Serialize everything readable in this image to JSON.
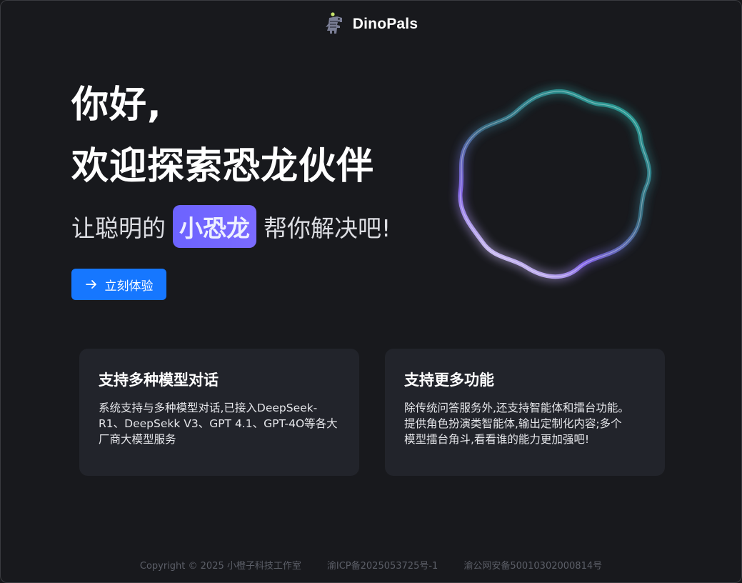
{
  "header": {
    "brand": "DinoPals",
    "logo_icon": "dinosaur-logo-icon"
  },
  "hero": {
    "greeting": "你好,",
    "title": "欢迎探索恐龙伙伴",
    "subtitle_before": "让聪明的",
    "subtitle_highlight": "小恐龙",
    "subtitle_after": "帮你解决吧!",
    "cta_label": "立刻体验",
    "cta_icon": "arrow-right-icon"
  },
  "colors": {
    "accent": "#1677ff",
    "highlight": "#6c63ff",
    "background": "#18191d",
    "card": "#22242b"
  },
  "cards": [
    {
      "title": "支持多种模型对话",
      "lines": [
        "系统支持与多种模型对话,已接入DeepSeek-",
        "R1、DeepSekk V3、GPT 4.1、GPT-4O等各大",
        "厂商大模型服务"
      ]
    },
    {
      "title": "支持更多功能",
      "lines": [
        "除传统问答服务外,还支持智能体和擂台功能。",
        "提供角色扮演类智能体,输出定制化内容;多个",
        "模型擂台角斗,看看谁的能力更加强吧!"
      ]
    }
  ],
  "footer": {
    "copyright": "Copyright © 2025 小橙子科技工作室",
    "icp": "渝ICP备2025053725号-1",
    "police": "渝公网安备50010302000814号"
  }
}
